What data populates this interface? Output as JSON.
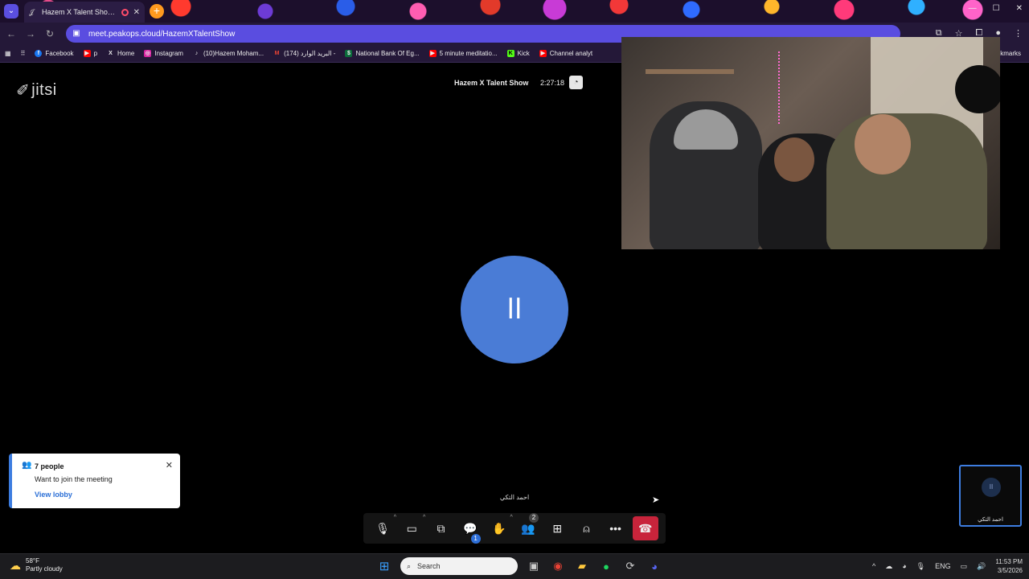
{
  "browser": {
    "tab_title": "Hazem X Talent Show | Jitsi",
    "url": "meet.peakops.cloud/HazemXTalentShow",
    "bookmarks": [
      {
        "label": "Facebook",
        "icon": "facebook-icon"
      },
      {
        "label": "p",
        "icon": "youtube-icon"
      },
      {
        "label": "Home",
        "icon": "x-icon"
      },
      {
        "label": "Instagram",
        "icon": "instagram-icon"
      },
      {
        "label": "(10)Hazem Moham...",
        "icon": "tiktok-icon"
      },
      {
        "label": "(174) البريد الوارد -",
        "icon": "gmail-icon"
      },
      {
        "label": "National Bank Of Eg...",
        "icon": "bank-icon"
      },
      {
        "label": "5 minute meditatio...",
        "icon": "youtube-icon"
      },
      {
        "label": "Kick",
        "icon": "kick-icon"
      },
      {
        "label": "Channel analyt",
        "icon": "youtube-icon"
      }
    ],
    "bookmarks_more": "kmarks"
  },
  "meeting": {
    "logo": "jitsi",
    "title": "Hazem X Talent Show",
    "duration": "2:27:18",
    "avatar_initials": "اا",
    "speaker_name": "احمد التكي",
    "self_initials": "اا",
    "self_name": "احمد التكي"
  },
  "lobby": {
    "count_label": "7 people",
    "message": "Want to join the meeting",
    "link": "View lobby"
  },
  "controls": {
    "chat_badge": "1",
    "participants_badge": "2"
  },
  "taskbar": {
    "temp": "58°F",
    "condition": "Partly cloudy",
    "search_placeholder": "Search",
    "lang": "ENG",
    "time": "11:53 PM",
    "date": "3/5/2026"
  }
}
